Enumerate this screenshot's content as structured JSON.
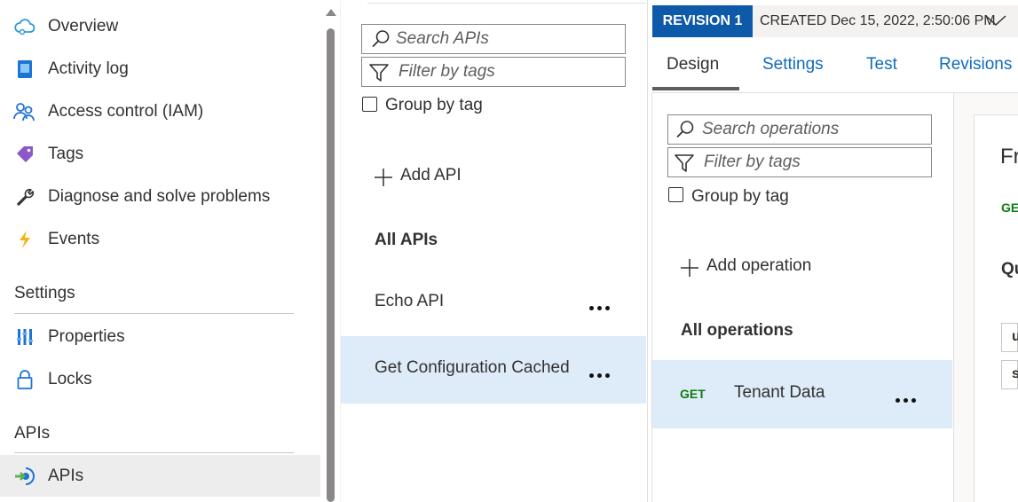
{
  "nav": {
    "items": [
      {
        "label": "Overview",
        "icon": "cloud-icon"
      },
      {
        "label": "Activity log",
        "icon": "activity-log-icon"
      },
      {
        "label": "Access control (IAM)",
        "icon": "people-icon"
      },
      {
        "label": "Tags",
        "icon": "tag-icon"
      },
      {
        "label": "Diagnose and solve problems",
        "icon": "wrench-icon"
      },
      {
        "label": "Events",
        "icon": "lightning-icon"
      }
    ],
    "settings_header": "Settings",
    "settings_items": [
      {
        "label": "Properties",
        "icon": "properties-icon"
      },
      {
        "label": "Locks",
        "icon": "lock-icon"
      }
    ],
    "apis_header": "APIs",
    "apis_items": [
      {
        "label": "APIs",
        "icon": "api-icon",
        "selected": true
      }
    ]
  },
  "api_panel": {
    "search_placeholder": "Search APIs",
    "filter_placeholder": "Filter by tags",
    "group_by_tag": "Group by tag",
    "add_api": "Add API",
    "all_apis": "All APIs",
    "apis": [
      {
        "name": "Echo API",
        "selected": false
      },
      {
        "name": "Get Configuration Cached",
        "selected": true
      }
    ]
  },
  "revision": {
    "badge": "REVISION 1",
    "created": "CREATED Dec 15, 2022, 2:50:06 PM"
  },
  "tabs": [
    {
      "label": "Design",
      "active": true
    },
    {
      "label": "Settings",
      "active": false
    },
    {
      "label": "Test",
      "active": false
    },
    {
      "label": "Revisions",
      "active": false
    }
  ],
  "operations": {
    "search_placeholder": "Search operations",
    "filter_placeholder": "Filter by tags",
    "group_by_tag": "Group by tag",
    "add_operation": "Add operation",
    "all_operations": "All operations",
    "items": [
      {
        "method": "GET",
        "name": "Tenant Data",
        "selected": true
      }
    ]
  },
  "detail": {
    "title_fragment": "Fr",
    "method_fragment": "GE",
    "section_fragment": "Qu",
    "field1_fragment": "u",
    "field2_fragment": "s"
  },
  "colors": {
    "accent": "#0f6cbd",
    "revision_badge": "#0f5aa8",
    "selection": "#deecf9",
    "get_method": "#107c10"
  }
}
